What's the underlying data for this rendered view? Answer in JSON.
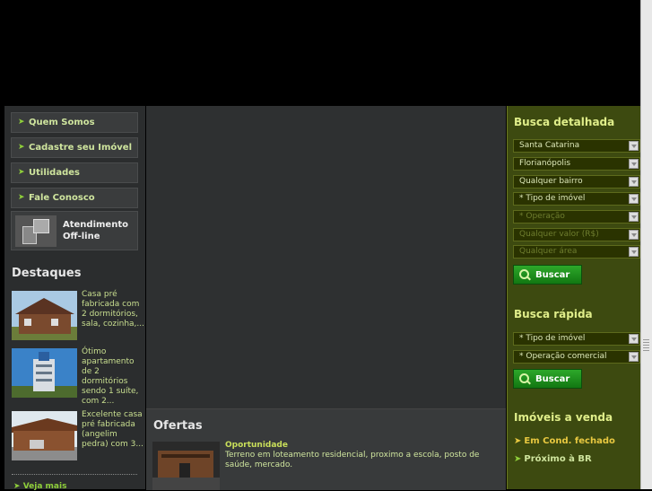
{
  "menu": [
    {
      "label": "Quem Somos"
    },
    {
      "label": "Cadastre seu Imóvel"
    },
    {
      "label": "Utilidades"
    },
    {
      "label": "Fale Conosco"
    }
  ],
  "atendimento": {
    "line1": "Atendimento",
    "line2": "Off-line"
  },
  "destaques": {
    "title": "Destaques",
    "items": [
      {
        "desc": "Casa pré fabricada com 2 dormitórios, sala, cozinha,..."
      },
      {
        "desc": "Ótimo apartamento de 2 dormitórios sendo 1 suíte, com 2..."
      },
      {
        "desc": "Excelente casa pré fabricada (angelim pedra) com 3..."
      }
    ],
    "more": "Veja mais"
  },
  "ofertas": {
    "title": "Ofertas",
    "item_title": "Oportunidade",
    "item_desc": "Terreno em loteamento residencial, proximo a escola, posto de saúde, mercado."
  },
  "busca_detalhada": {
    "title": "Busca detalhada",
    "selects": [
      "Santa Catarina",
      "Florianópolis",
      "Qualquer bairro",
      "* Tipo de imóvel",
      "* Operação",
      "Qualquer valor (R$)",
      "Qualquer área"
    ],
    "button": "Buscar"
  },
  "busca_rapida": {
    "title": "Busca rápida",
    "selects": [
      "* Tipo de imóvel",
      "* Operação comercial"
    ],
    "button": "Buscar"
  },
  "imoveis": {
    "title": "Imóveis a venda",
    "links": [
      "Em Cond. fechado",
      "Próximo à BR"
    ]
  }
}
